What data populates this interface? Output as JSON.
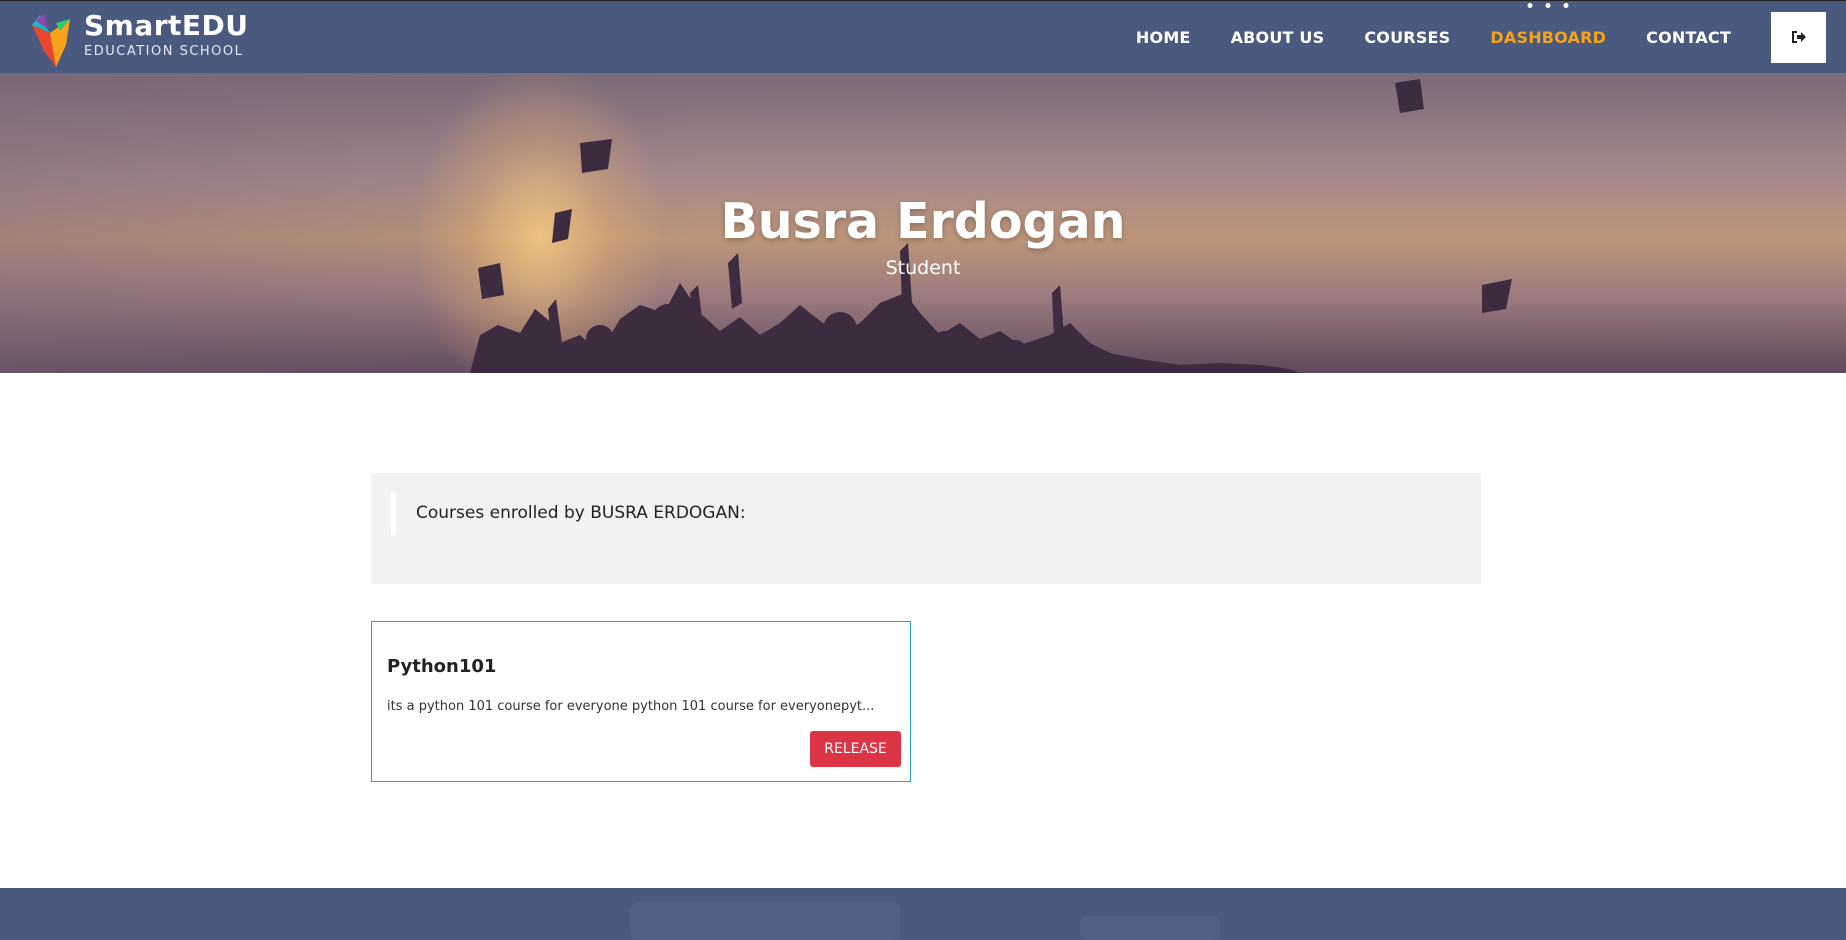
{
  "brand": {
    "name": "SmartEDU",
    "tagline": "EDUCATION SCHOOL",
    "colors": {
      "header": "#4a5a7f",
      "accent": "#f6a21a",
      "danger": "#dc3545",
      "card_border": "#2aa4b5"
    }
  },
  "nav": {
    "items": [
      {
        "label": "HOME",
        "active": false
      },
      {
        "label": "ABOUT US",
        "active": false
      },
      {
        "label": "COURSES",
        "active": false
      },
      {
        "label": "DASHBOARD",
        "active": true
      },
      {
        "label": "CONTACT",
        "active": false
      }
    ],
    "logout_icon": "sign-out-icon"
  },
  "hero": {
    "name": "Busra Erdogan",
    "role": "Student"
  },
  "enrolled": {
    "heading": "Courses enrolled by BUSRA ERDOGAN:"
  },
  "courses": [
    {
      "title": "Python101",
      "description": "its a python 101 course for everyone python 101 course for everyonepyt...",
      "action_label": "RELEASE"
    }
  ]
}
